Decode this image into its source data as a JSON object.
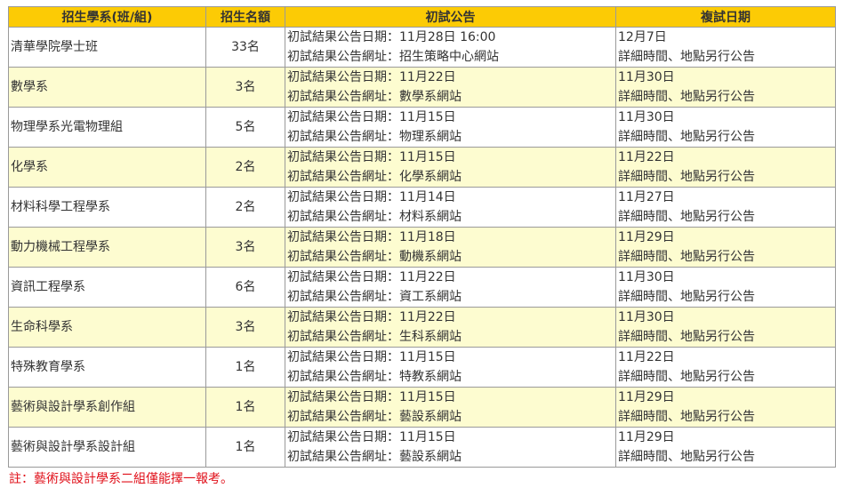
{
  "table": {
    "headers": [
      "招生學系(班/組)",
      "招生名額",
      "初試公告",
      "複試日期"
    ],
    "rows": [
      {
        "dept": "清華學院學士班",
        "quota": "33名",
        "notice_date": "初試結果公告日期：11月28日 16:00",
        "notice_site": "初試結果公告網址：招生策略中心網站",
        "exam_date": "12月7日",
        "exam_note": "詳細時間、地點另行公告"
      },
      {
        "dept": "數學系",
        "quota": "3名",
        "notice_date": "初試結果公告日期：11月22日",
        "notice_site": "初試結果公告網址：數學系網站",
        "exam_date": "11月30日",
        "exam_note": "詳細時間、地點另行公告"
      },
      {
        "dept": "物理學系光電物理組",
        "quota": "5名",
        "notice_date": "初試結果公告日期：11月15日",
        "notice_site": "初試結果公告網址：物理系網站",
        "exam_date": "11月30日",
        "exam_note": "詳細時間、地點另行公告"
      },
      {
        "dept": "化學系",
        "quota": "2名",
        "notice_date": "初試結果公告日期：11月15日",
        "notice_site": "初試結果公告網址：化學系網站",
        "exam_date": "11月22日",
        "exam_note": "詳細時間、地點另行公告"
      },
      {
        "dept": "材料科學工程學系",
        "quota": "2名",
        "notice_date": "初試結果公告日期：11月14日",
        "notice_site": "初試結果公告網址：材料系網站",
        "exam_date": "11月27日",
        "exam_note": "詳細時間、地點另行公告"
      },
      {
        "dept": "動力機械工程學系",
        "quota": "3名",
        "notice_date": "初試結果公告日期：11月18日",
        "notice_site": "初試結果公告網址：動機系網站",
        "exam_date": "11月29日",
        "exam_note": "詳細時間、地點另行公告"
      },
      {
        "dept": "資訊工程學系",
        "quota": "6名",
        "notice_date": "初試結果公告日期：11月22日",
        "notice_site": "初試結果公告網址：資工系網站",
        "exam_date": "11月30日",
        "exam_note": "詳細時間、地點另行公告"
      },
      {
        "dept": "生命科學系",
        "quota": "3名",
        "notice_date": "初試結果公告日期：11月22日",
        "notice_site": "初試結果公告網址：生科系網站",
        "exam_date": "11月30日",
        "exam_note": "詳細時間、地點另行公告"
      },
      {
        "dept": "特殊教育學系",
        "quota": "1名",
        "notice_date": "初試結果公告日期：11月15日",
        "notice_site": "初試結果公告網址：特教系網站",
        "exam_date": "11月22日",
        "exam_note": "詳細時間、地點另行公告"
      },
      {
        "dept": "藝術與設計學系創作組",
        "quota": "1名",
        "notice_date": "初試結果公告日期：11月15日",
        "notice_site": "初試結果公告網址：藝設系網站",
        "exam_date": "11月29日",
        "exam_note": "詳細時間、地點另行公告"
      },
      {
        "dept": "藝術與設計學系設計組",
        "quota": "1名",
        "notice_date": "初試結果公告日期：11月15日",
        "notice_site": "初試結果公告網址：藝設系網站",
        "exam_date": "11月29日",
        "exam_note": "詳細時間、地點另行公告"
      }
    ]
  },
  "note": "註：藝術與設計學系二組僅能擇一報考。",
  "colors": {
    "header_bg": "#FCCB05",
    "alt_row_bg": "#FDFCD0",
    "border": "#9a9a9a",
    "note_text": "#E0101A"
  }
}
